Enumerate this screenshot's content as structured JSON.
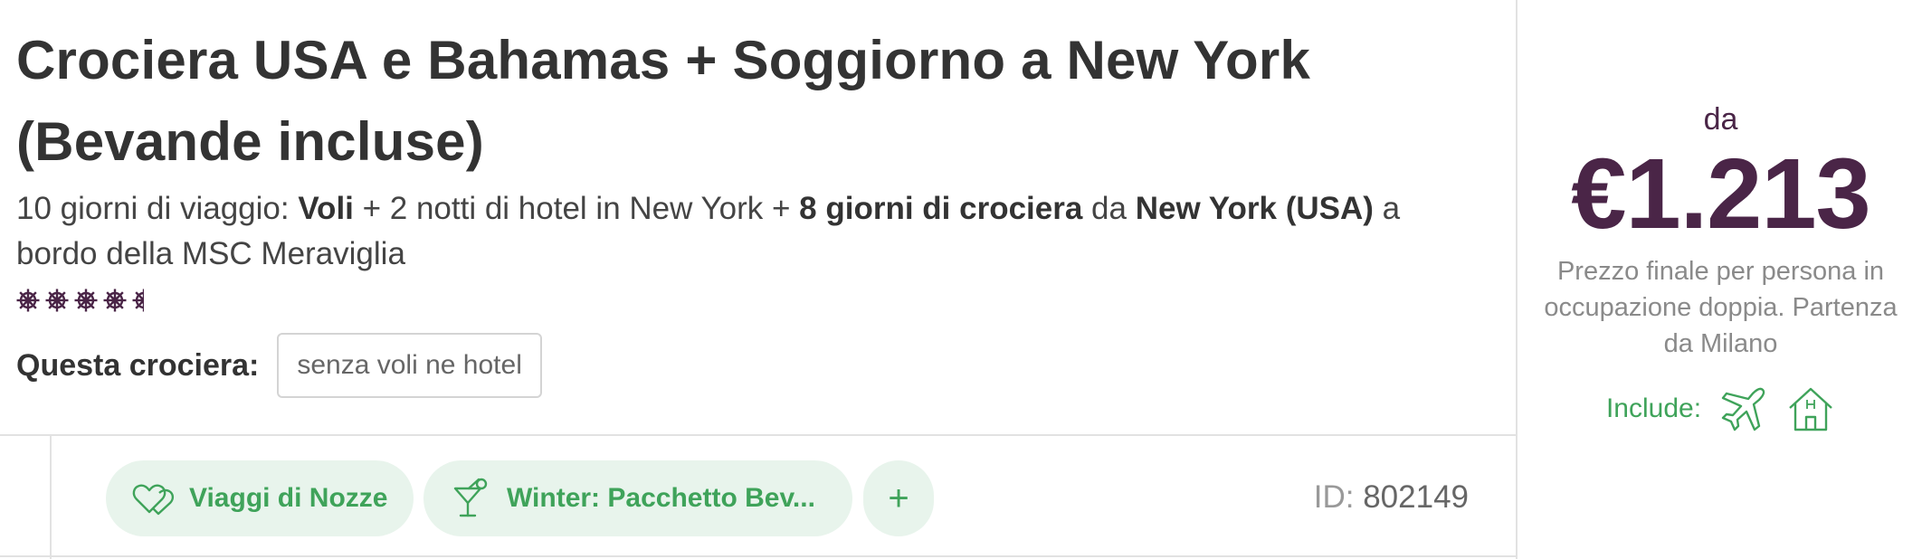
{
  "offer": {
    "title": "Crociera USA e Bahamas + Soggiorno a New York (Bevande incluse)",
    "subtitle": {
      "p1": "10 giorni di viaggio: ",
      "p2": "Voli",
      "p3": " + 2 notti di hotel in New York + ",
      "p4": "8 giorni di crociera",
      "p5": " da ",
      "p6": "New York (USA)",
      "p7": " a bordo della MSC Meraviglia"
    },
    "rating": {
      "value": 4.5,
      "max": 5,
      "icon": "ship-wheel-icon",
      "color": "#4a2547"
    }
  },
  "choice": {
    "label": "Questa crociera:",
    "selected": "senza voli ne hotel"
  },
  "tags": [
    {
      "label": "Viaggi di Nozze",
      "icon": "hearts-icon"
    },
    {
      "label": "Winter: Pacchetto Bev...",
      "icon": "cocktail-icon"
    }
  ],
  "more_tags_label": "+",
  "id": {
    "label": "ID:",
    "value": "802149"
  },
  "price": {
    "from_label": "da",
    "amount": "€1.213",
    "note": "Prezzo finale per persona in occupazione doppia. Partenza da Milano",
    "include_label": "Include:",
    "include_icons": [
      "airplane-icon",
      "hotel-icon"
    ]
  },
  "colors": {
    "accent_purple": "#4a2547",
    "accent_green": "#3fa35a",
    "tag_bg": "#e8f4ec"
  }
}
